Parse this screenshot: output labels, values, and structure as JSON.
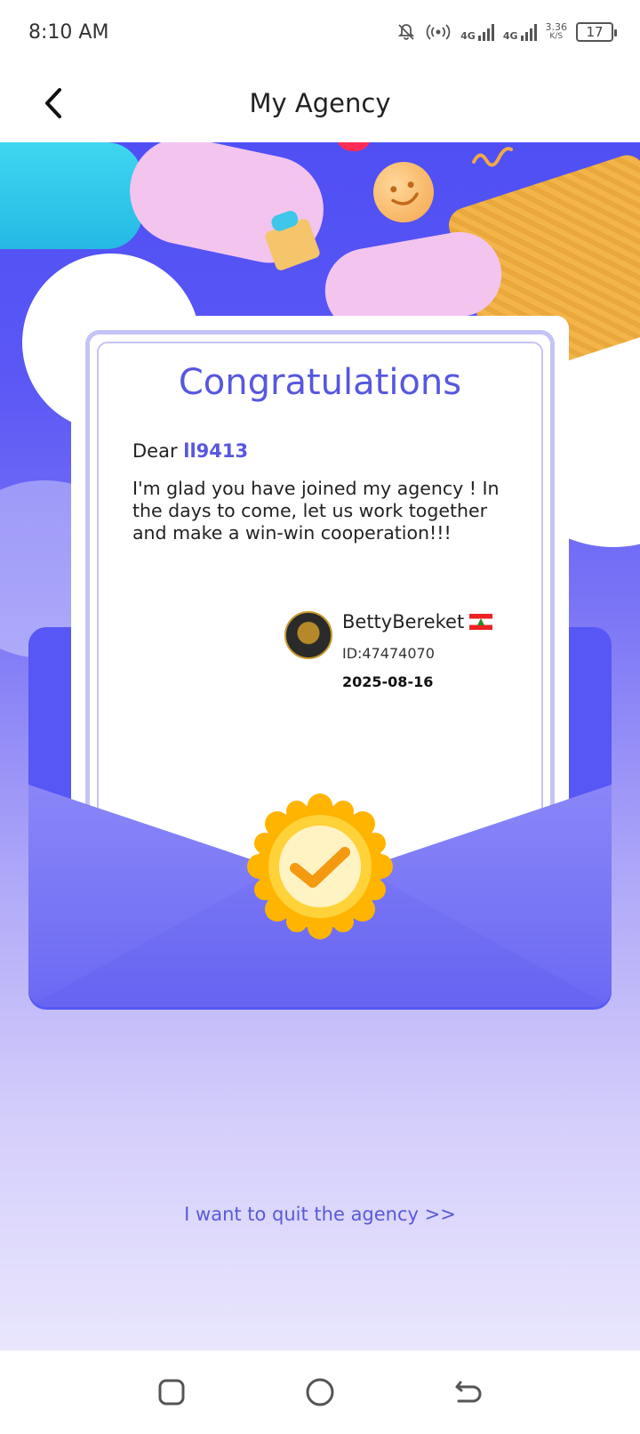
{
  "status_bar": {
    "time": "8:10 AM",
    "network1": "4G",
    "network2": "4G",
    "speed_value": "3.36",
    "speed_unit": "K/S",
    "battery": "17"
  },
  "header": {
    "title": "My Agency",
    "back_icon": "chevron-left-icon"
  },
  "letter": {
    "heading": "Congratulations",
    "greeting": "Dear",
    "recipient": "ll9413",
    "message": "I'm glad you have joined my agency ! In the days to come, let us work together and make a win-win cooperation!!!",
    "signer_name": "BettyBereket",
    "signer_flag": "lebanon-flag-icon",
    "signer_id": "ID:47474070",
    "date": "2025-08-16"
  },
  "footer": {
    "quit_link": "I want to quit the agency >>"
  },
  "nav": {
    "recent": "square-icon",
    "home": "circle-icon",
    "back": "back-arrow-icon"
  },
  "colors": {
    "accent": "#5757e0",
    "hero_top": "#4f4ff4",
    "seal": "#ffb300"
  }
}
